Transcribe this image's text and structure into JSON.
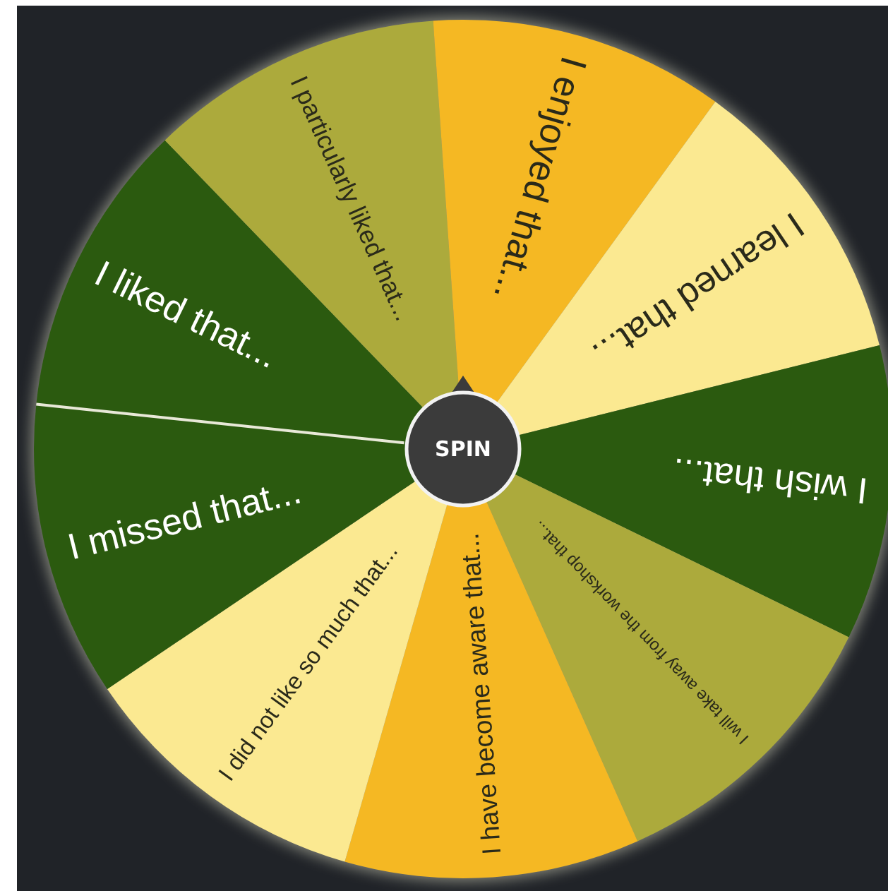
{
  "wheel": {
    "segments": [
      {
        "label": "I liked that...",
        "color": "#2b5a0f"
      },
      {
        "label": "I particularly liked that...",
        "color": "#acaa3c"
      },
      {
        "label": "I enjoyed that...",
        "color": "#f5b823"
      },
      {
        "label": "I learned that...",
        "color": "#fbe991"
      },
      {
        "label": "I wish that...",
        "color": "#2b5a0f"
      },
      {
        "label": "I will take away from the workshop that...",
        "color": "#acaa3c"
      },
      {
        "label": "I have become aware that...",
        "color": "#f5b823"
      },
      {
        "label": "I did not like so much that...",
        "color": "#fbe991"
      },
      {
        "label": "I missed that...",
        "color": "#2b5a0f"
      }
    ]
  },
  "spin_button": {
    "label": "SPIN"
  }
}
